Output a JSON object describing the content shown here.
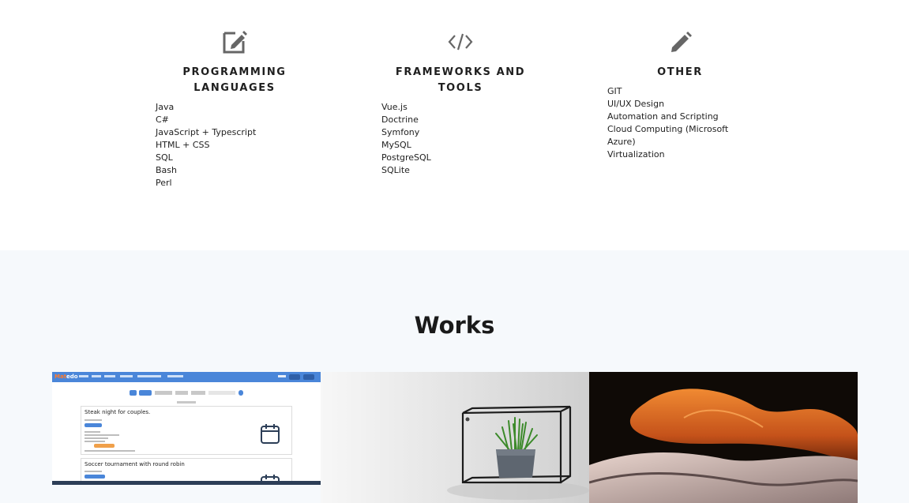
{
  "skills": [
    {
      "icon": "edit-square-icon",
      "title_line1": "PROGRAMMING",
      "title_line2": "LANGUAGES",
      "items": [
        "Java",
        "C#",
        "JavaScript + Typescript",
        "HTML + CSS",
        "SQL",
        "Bash",
        "Perl"
      ]
    },
    {
      "icon": "code-icon",
      "title_line1": "FRAMEWORKS AND TOOLS",
      "title_line2": "",
      "items": [
        "Vue.js",
        "Doctrine",
        "Symfony",
        "MySQL",
        "PostgreSQL",
        "SQLite"
      ]
    },
    {
      "icon": "pencil-icon",
      "title_line1": "OTHER",
      "title_line2": "",
      "items": [
        "GIT",
        "UI/UX Design",
        "Automation and Scripting",
        "Cloud Computing (Microsoft Azure)",
        "Virtualization"
      ]
    }
  ],
  "works": {
    "title": "Works",
    "tiles": [
      {
        "kind": "app-screenshot",
        "logo_part1": "Mat",
        "logo_part2": "edo",
        "card1_title": "Steak night for couples.",
        "card2_title": "Soccer tournament with round robin",
        "icon": "calendar-icon"
      },
      {
        "kind": "photo",
        "subject": "plant-shelf-photo"
      },
      {
        "kind": "photo",
        "subject": "canyon-photo"
      }
    ]
  },
  "colors": {
    "section_bg": "#f6f9fc",
    "icon_gray": "#666666",
    "nav_blue": "#4a86d9",
    "badge_orange": "#f0a04a"
  }
}
